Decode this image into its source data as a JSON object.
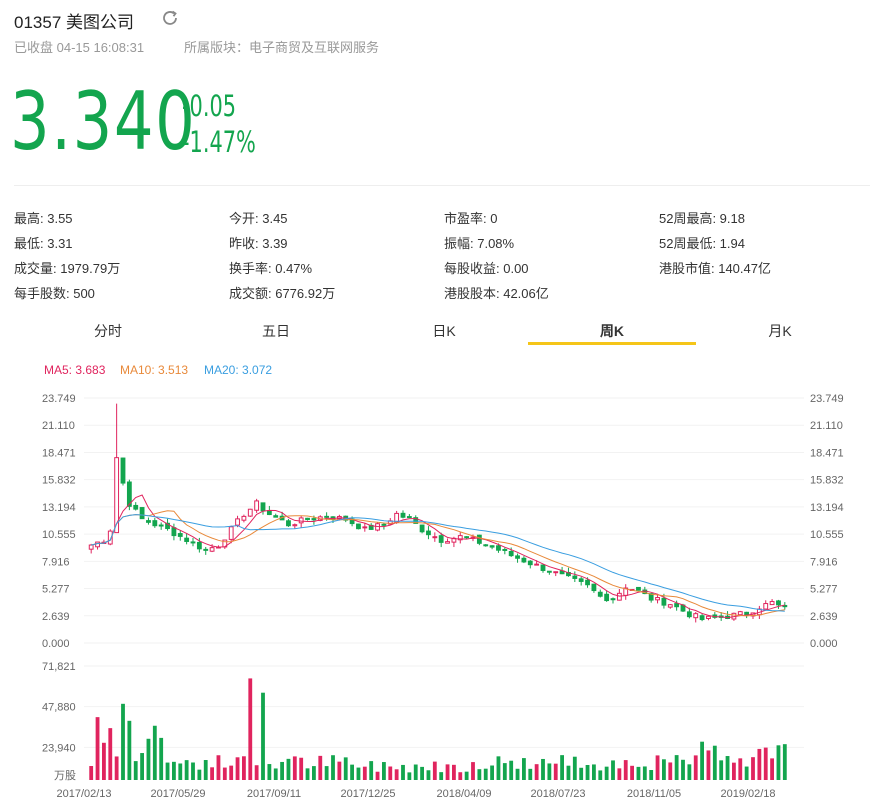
{
  "header": {
    "code": "01357",
    "name": "美图公司",
    "status": "已收盘 04-15 16:08:31",
    "sector": "所属版块：电子商贸及互联网服务"
  },
  "quote": {
    "price": "3.340",
    "change": "-0.05",
    "change_pct": "-1.47%"
  },
  "stats": [
    [
      "最高: 3.55",
      "今开: 3.45",
      "市盈率: 0",
      "52周最高: 9.18"
    ],
    [
      "最低: 3.31",
      "昨收: 3.39",
      "振幅: 7.08%",
      "52周最低: 1.94"
    ],
    [
      "成交量: 1979.79万",
      "换手率: 0.47%",
      "每股收益: 0.00",
      "港股市值: 140.47亿"
    ],
    [
      "每手股数: 500",
      "成交额: 6776.92万",
      "港股股本: 42.06亿",
      ""
    ]
  ],
  "tabs": [
    "分时",
    "五日",
    "日K",
    "周K",
    "月K"
  ],
  "active_tab": 3,
  "colors": {
    "up": "#e0245e",
    "down": "#13a54e",
    "ma5": "#e0245e",
    "ma10": "#e8893a",
    "ma20": "#3a9ee0",
    "accent": "#f5c518"
  },
  "chart_data": {
    "type": "candlestick",
    "legend": {
      "ma5": "MA5: 3.683",
      "ma10": "MA10: 3.513",
      "ma20": "MA20: 3.072"
    },
    "price_axis": {
      "ylim": [
        0,
        23.749
      ],
      "ticks": [
        "23.749",
        "21.110",
        "18.471",
        "15.832",
        "13.194",
        "10.555",
        "7.916",
        "5.277",
        "2.639",
        "0.000"
      ]
    },
    "volume_axis": {
      "ylim": [
        0,
        71821
      ],
      "ticks": [
        "71,821",
        "47,880",
        "23,940"
      ],
      "unit": "万股"
    },
    "x_ticks": [
      "2017/02/13",
      "2017/05/29",
      "2017/09/11",
      "2017/12/25",
      "2018/04/09",
      "2018/07/23",
      "2018/11/05",
      "2019/02/18"
    ],
    "ohlc_waypoints": [
      [
        0,
        9.5
      ],
      [
        2,
        10.0
      ],
      [
        3,
        11.0
      ],
      [
        4,
        18.0
      ],
      [
        5,
        15.5
      ],
      [
        6,
        13.5
      ],
      [
        8,
        12.0
      ],
      [
        10,
        11.5
      ],
      [
        12,
        11.0
      ],
      [
        15,
        10.0
      ],
      [
        18,
        9.0
      ],
      [
        20,
        9.5
      ],
      [
        22,
        11.0
      ],
      [
        24,
        12.5
      ],
      [
        26,
        13.5
      ],
      [
        28,
        12.5
      ],
      [
        31,
        11.5
      ],
      [
        34,
        12.0
      ],
      [
        37,
        12.3
      ],
      [
        40,
        12.0
      ],
      [
        43,
        11.0
      ],
      [
        46,
        11.5
      ],
      [
        48,
        12.5
      ],
      [
        50,
        12.0
      ],
      [
        52,
        11.0
      ],
      [
        55,
        10.0
      ],
      [
        58,
        10.3
      ],
      [
        60,
        10.0
      ],
      [
        63,
        9.3
      ],
      [
        66,
        8.5
      ],
      [
        70,
        7.5
      ],
      [
        74,
        6.5
      ],
      [
        78,
        5.5
      ],
      [
        80,
        4.5
      ],
      [
        82,
        4.3
      ],
      [
        84,
        5.5
      ],
      [
        86,
        5.0
      ],
      [
        88,
        4.3
      ],
      [
        91,
        3.8
      ],
      [
        94,
        2.8
      ],
      [
        96,
        2.3
      ],
      [
        99,
        2.5
      ],
      [
        103,
        2.9
      ],
      [
        105,
        3.5
      ],
      [
        107,
        3.9
      ],
      [
        109,
        3.3
      ]
    ],
    "ma5_last": 3.683,
    "ma10_last": 3.513,
    "ma20_last": 3.072
  }
}
